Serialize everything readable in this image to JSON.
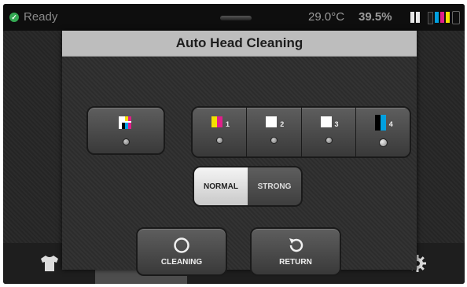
{
  "status_bar": {
    "status_text": "Ready",
    "temperature": "29.0°C",
    "humidity": "39.5%",
    "ink_colors": [
      "#e8e8e8",
      "#1a1a1a",
      "#00a0e0",
      "#e01f8a",
      "#f4e000"
    ]
  },
  "dialog": {
    "title": "Auto Head Cleaning",
    "mode_options": [
      "NORMAL",
      "STRONG"
    ],
    "selected_mode": "NORMAL",
    "ink_heads": [
      {
        "number": "1",
        "colors": [
          "#f4e000",
          "#e01f8a"
        ]
      },
      {
        "number": "2",
        "colors": [
          "#ffffff"
        ]
      },
      {
        "number": "3",
        "colors": [
          "#ffffff"
        ]
      },
      {
        "number": "4",
        "colors": [
          "#000000",
          "#00a0e0"
        ]
      }
    ],
    "cleaning_label": "CLEANING",
    "return_label": "RETURN"
  },
  "bottom_nav": {
    "items": [
      "tshirt-icon",
      "printhead-icon",
      "platen-icon",
      "ink-icon",
      "gear-icon"
    ]
  }
}
